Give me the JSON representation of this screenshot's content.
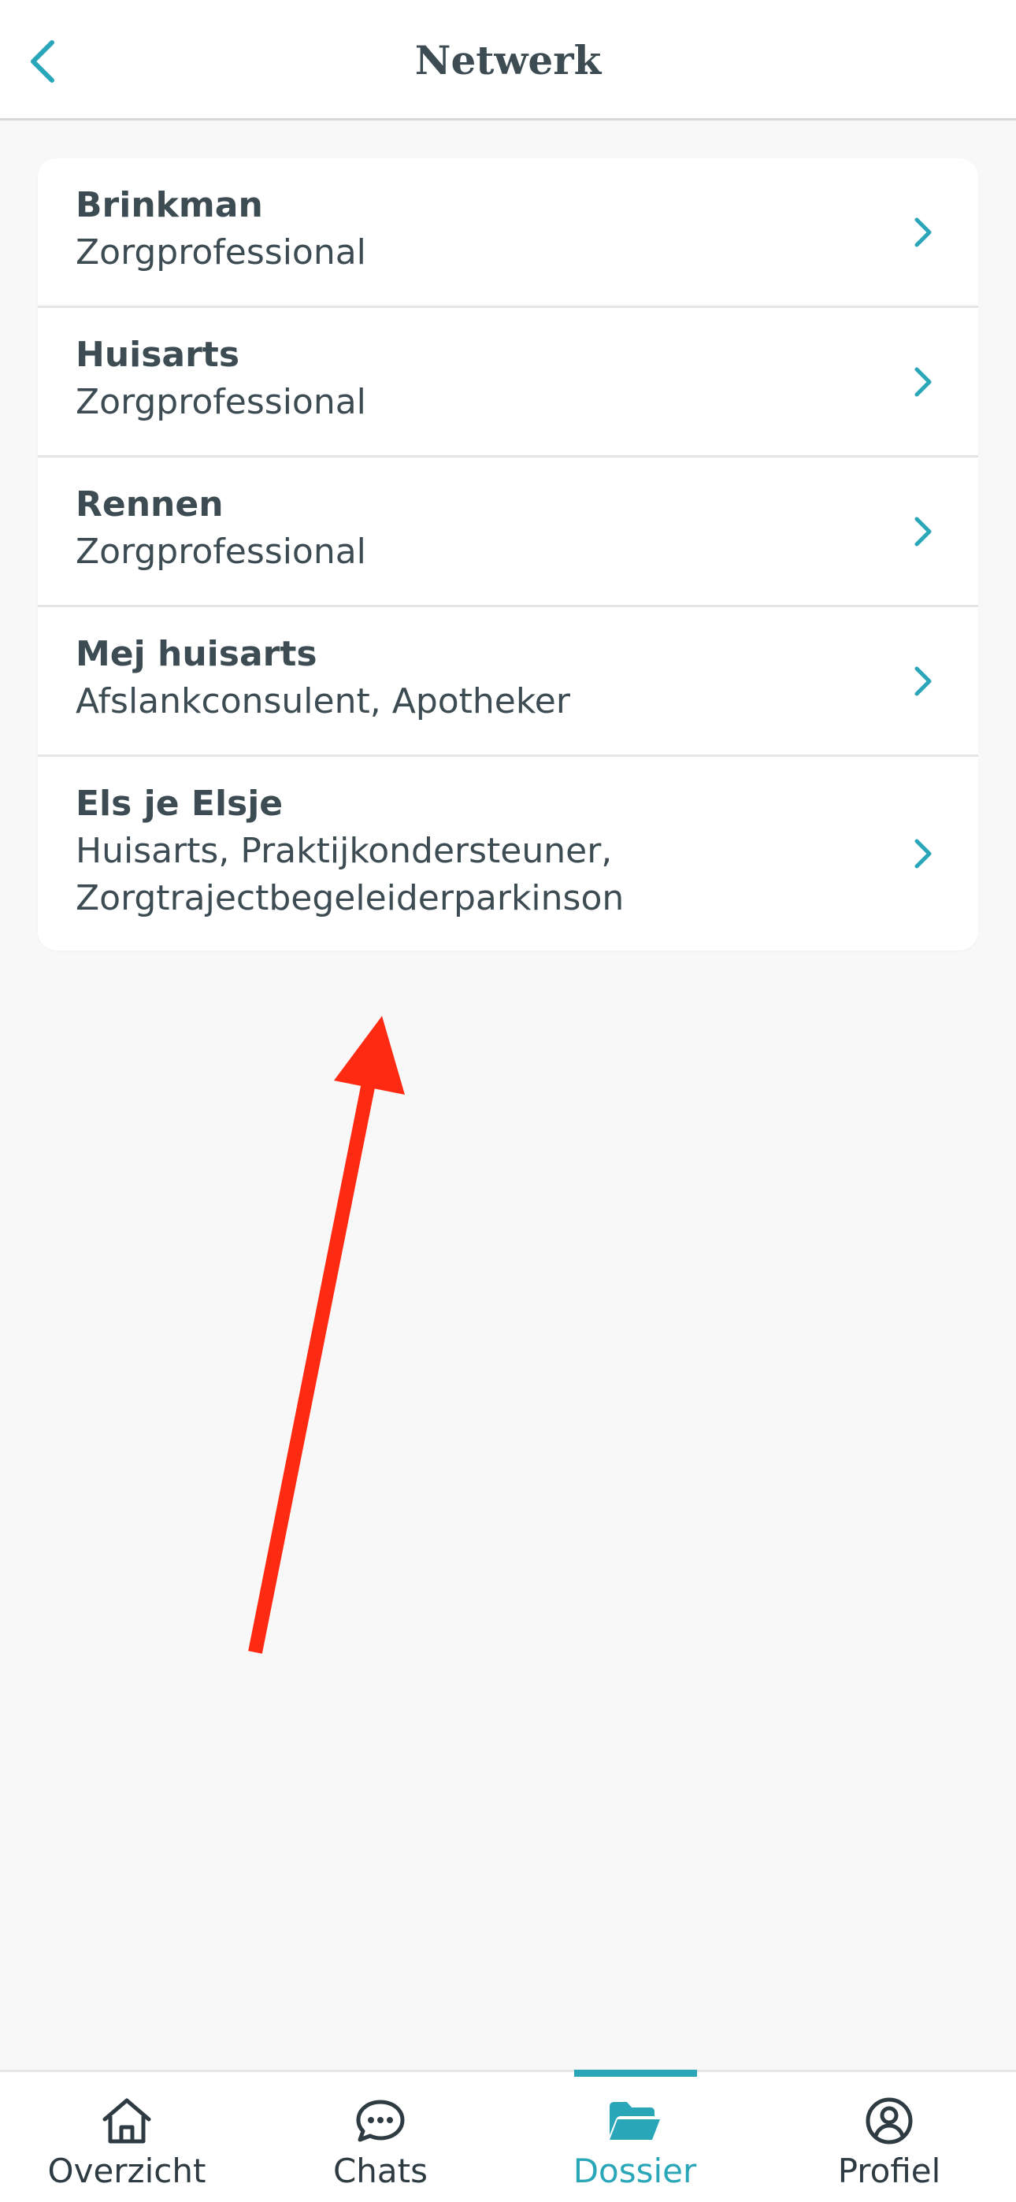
{
  "header": {
    "title": "Netwerk",
    "back_icon": "chevron-left-icon"
  },
  "contacts": [
    {
      "name": "Brinkman",
      "role": "Zorgprofessional"
    },
    {
      "name": "Huisarts",
      "role": "Zorgprofessional"
    },
    {
      "name": "Rennen",
      "role": "Zorgprofessional"
    },
    {
      "name": "Mej huisarts",
      "role": "Afslankconsulent, Apotheker"
    },
    {
      "name": "Els je Elsje",
      "role": "Huisarts, Praktijkondersteuner, Zorgtrajectbegeleiderparkinson"
    }
  ],
  "tabbar": {
    "tabs": [
      {
        "label": "Overzicht",
        "icon": "home-icon",
        "active": false
      },
      {
        "label": "Chats",
        "icon": "chat-bubble-icon",
        "active": false
      },
      {
        "label": "Dossier",
        "icon": "folder-open-icon",
        "active": true
      },
      {
        "label": "Profiel",
        "icon": "user-circle-icon",
        "active": false
      }
    ]
  },
  "colors": {
    "accent": "#2aa6b9",
    "text": "#3d4b53",
    "background": "#f8f8f8",
    "annotation_arrow": "#ff2a12"
  }
}
